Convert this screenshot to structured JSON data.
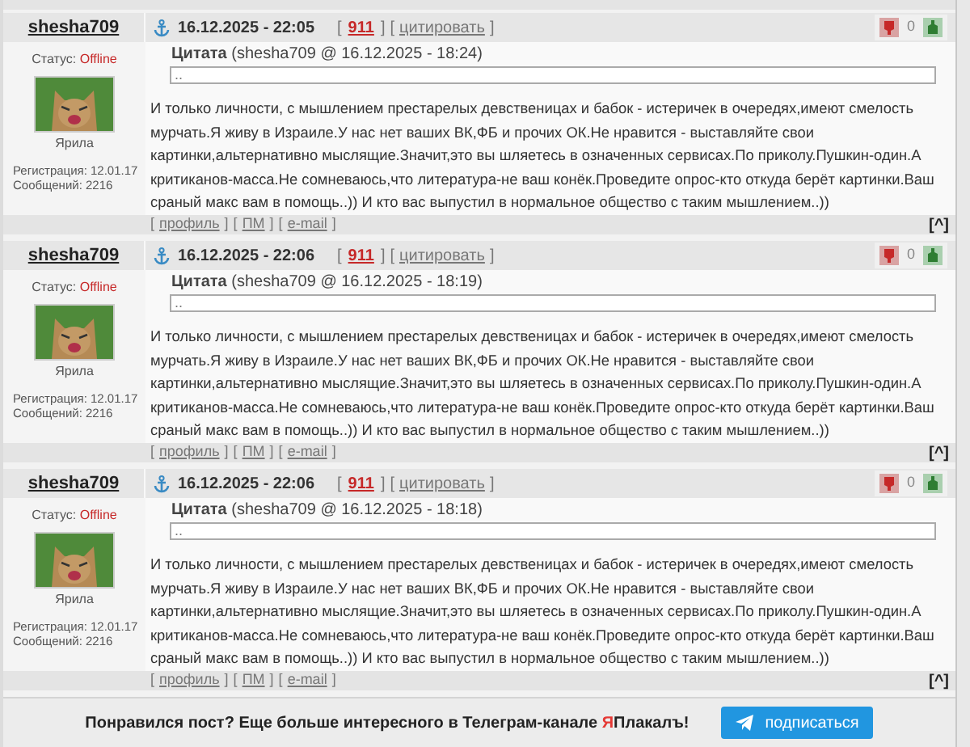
{
  "posts": [
    {
      "author": "shesha709",
      "status_label": "Статус:",
      "status": "Offline",
      "avatar_caption": "Ярила",
      "registration": "Регистрация: 12.01.17",
      "messages": "Сообщений: 2216",
      "date": "16.12.2025 - 22:05",
      "post_number": "911",
      "quote_link": "цитировать",
      "rating": "0",
      "quote_title": "**Цитата** (shesha709 @ 16.12.2025 - 18:24)",
      "quote_text": "..",
      "text": "И только личности, с мышлением престарелых девственицах и бабок - истеричек в очередях,имеют смелость мурчать.Я живу в Израиле.У нас нет ваших ВК,ФБ и прочих ОК.Не нравится - выставляйте свои картинки,альтернативно мыслящие.Значит,это вы шляетесь в означенных сервисах.По приколу.Пушкин-один.А критиканов-масса.Не сомневаюсь,что литература-не ваш конёк.Проведите опрос-кто откуда берёт картинки.Ваш сраный макс вам в помощь..)) И кто вас выпустил в нормальное общество с таким мышлением..))",
      "links": [
        "профиль",
        "ПМ",
        "e-mail"
      ],
      "top_link": "[^]"
    },
    {
      "author": "shesha709",
      "status_label": "Статус:",
      "status": "Offline",
      "avatar_caption": "Ярила",
      "registration": "Регистрация: 12.01.17",
      "messages": "Сообщений: 2216",
      "date": "16.12.2025 - 22:06",
      "post_number": "911",
      "quote_link": "цитировать",
      "rating": "0",
      "quote_title": "**Цитата** (shesha709 @ 16.12.2025 - 18:19)",
      "quote_text": "..",
      "text": "И только личности, с мышлением престарелых девственицах и бабок - истеричек в очередях,имеют смелость мурчать.Я живу в Израиле.У нас нет ваших ВК,ФБ и прочих ОК.Не нравится - выставляйте свои картинки,альтернативно мыслящие.Значит,это вы шляетесь в означенных сервисах.По приколу.Пушкин-один.А критиканов-масса.Не сомневаюсь,что литература-не ваш конёк.Проведите опрос-кто откуда берёт картинки.Ваш сраный макс вам в помощь..)) И кто вас выпустил в нормальное общество с таким мышлением..))",
      "links": [
        "профиль",
        "ПМ",
        "e-mail"
      ],
      "top_link": "[^]"
    },
    {
      "author": "shesha709",
      "status_label": "Статус:",
      "status": "Offline",
      "avatar_caption": "Ярила",
      "registration": "Регистрация: 12.01.17",
      "messages": "Сообщений: 2216",
      "date": "16.12.2025 - 22:06",
      "post_number": "911",
      "quote_link": "цитировать",
      "rating": "0",
      "quote_title": "**Цитата** (shesha709 @ 16.12.2025 - 18:18)",
      "quote_text": "..",
      "text": "И только личности, с мышлением престарелых девственицах и бабок - истеричек в очередях,имеют смелость мурчать.Я живу в Израиле.У нас нет ваших ВК,ФБ и прочих ОК.Не нравится - выставляйте свои картинки,альтернативно мыслящие.Значит,это вы шляетесь в означенных сервисах.По приколу.Пушкин-один.А критиканов-масса.Не сомневаюсь,что литература-не ваш конёк.Проведите опрос-кто откуда берёт картинки.Ваш сраный макс вам в помощь..)) И кто вас выпустил в нормальное общество с таким мышлением..))",
      "links": [
        "профиль",
        "ПМ",
        "e-mail"
      ],
      "top_link": "[^]"
    }
  ],
  "brackets": {
    "open": "[",
    "close": "]"
  },
  "banner": {
    "text": "Понравился пост? Еще больше интересного в Телеграм-канале ",
    "brand_mark": "Я",
    "brand_rest": "Плакалъ!",
    "button": "подписаться"
  }
}
